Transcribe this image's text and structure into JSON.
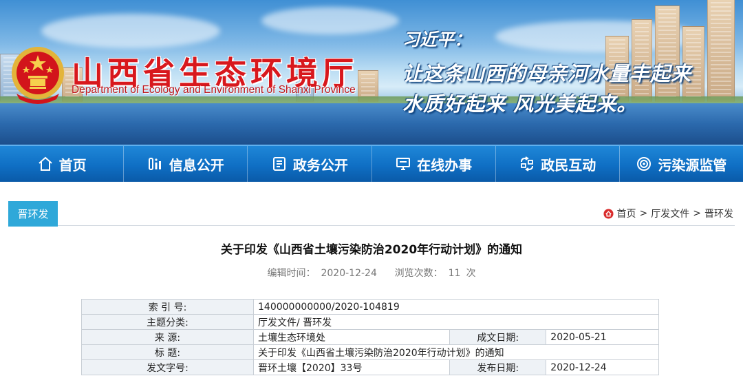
{
  "banner": {
    "title_cn": "山西省生态环境厅",
    "title_en": "Department of Ecology and Environment of Shanxi Province",
    "quote_author": "习近平：",
    "quote_line1": "让这条山西的母亲河水量丰起来",
    "quote_line2": "水质好起来  风光美起来。"
  },
  "nav": {
    "items": [
      {
        "label": "首页",
        "icon": "home-icon"
      },
      {
        "label": "信息公开",
        "icon": "info-icon"
      },
      {
        "label": "政务公开",
        "icon": "document-icon"
      },
      {
        "label": "在线办事",
        "icon": "monitor-icon"
      },
      {
        "label": "政民互动",
        "icon": "interaction-icon"
      },
      {
        "label": "污染源监管",
        "icon": "target-icon"
      }
    ]
  },
  "category_tab": "晋环发",
  "breadcrumb": {
    "home": "首页",
    "sep": ">",
    "level1": "厅发文件",
    "level2": "晋环发"
  },
  "document": {
    "title": "关于印发《山西省土壤污染防治2020年行动计划》的通知",
    "edit_time_label": "编辑时间：",
    "edit_time": "2020-12-24",
    "views_label": "浏览次数：",
    "views": "11",
    "views_unit": "次"
  },
  "info_table": {
    "index_label": "索 引 号:",
    "index_value": "140000000000/2020-104819",
    "topic_label": "主题分类:",
    "topic_value": "厅发文件/ 晋环发",
    "source_label": "来      源:",
    "source_value": "土壤生态环境处",
    "created_label": "成文日期:",
    "created_value": "2020-05-21",
    "subject_label": "标      题:",
    "subject_value": "关于印发《山西省土壤污染防治2020年行动计划》的通知",
    "docno_label": "发文字号:",
    "docno_value": "晋环土壤【2020】33号",
    "published_label": "发布日期:",
    "published_value": "2020-12-24"
  },
  "colors": {
    "nav_blue": "#0f6fc4",
    "title_red": "#d8181d",
    "tab_cyan": "#2fa8d9",
    "crumb_home_red": "#d92b2b"
  }
}
